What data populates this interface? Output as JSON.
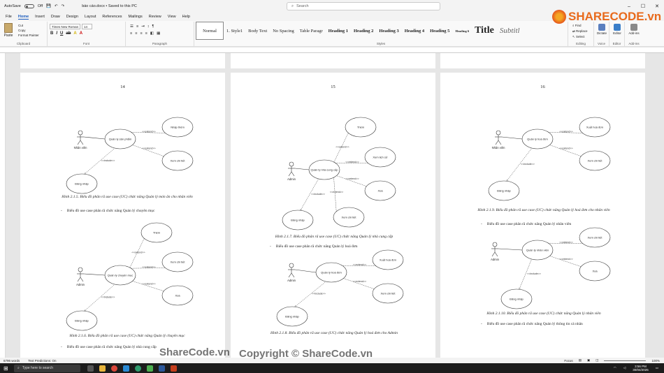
{
  "titlebar": {
    "autosave": "AutoSave",
    "autosave_state": "Off",
    "doc_title": "báo cáo.docx • Saved to this PC",
    "search_placeholder": "Search"
  },
  "menu": [
    "File",
    "Home",
    "Insert",
    "Draw",
    "Design",
    "Layout",
    "References",
    "Mailings",
    "Review",
    "View",
    "Help"
  ],
  "ribbon": {
    "clipboard": {
      "paste": "Paste",
      "cut": "Cut",
      "copy": "Copy",
      "format_painter": "Format Painter",
      "label": "Clipboard"
    },
    "font": {
      "name": "Times New Roman",
      "size": "14",
      "label": "Font"
    },
    "paragraph_label": "Paragraph",
    "styles": [
      "Normal",
      "1. Style1",
      "Body Text",
      "No Spacing",
      "Table Paragr",
      "Heading 1",
      "Heading 2",
      "Heading 3",
      "Heading 4",
      "Heading 5",
      "Heading 6",
      "Title",
      "Subtitl"
    ],
    "styles_label": "Styles",
    "editing": {
      "find": "Find",
      "replace": "Replace",
      "select": "Select",
      "label": "Editing"
    },
    "voice": {
      "dictate": "Dictate",
      "label": "Voice"
    },
    "editor": {
      "name": "Editor",
      "label": "Editor"
    },
    "addins": {
      "name": "Add-ins",
      "label": "Add-ins"
    }
  },
  "pages": [
    {
      "number": "14",
      "d1": {
        "actor": "Nhân viên",
        "center": "Quản lý sản phẩm",
        "ext": [
          "Nhập thêm",
          "Xem chi tiết"
        ],
        "login": "Đăng nhập",
        "extend": "<<extend>>",
        "include": "<<include>>"
      },
      "cap1": "Hình 2.1.5. Biểu đồ phân rã use case (UC) chức năng Quản lý món ăn cho nhân viên",
      "bullet1": "Biểu đồ use case phân rã chức năng Quản lý chuyên mục",
      "d2": {
        "actor": "Admin",
        "center": "Quản lý chuyên mục",
        "ext": [
          "Thêm",
          "Xem chi tiết",
          "Xoá"
        ],
        "login": "Đăng nhập",
        "extend": "<<extend>>",
        "include": "<<include>>"
      },
      "cap2": "Hình 2.1.6. Biểu đồ phân rã use case (UC) chức năng Quản lý chuyên mục",
      "bullet2": "Biểu đồ use case phân rã chức năng Quản lý nhà cung cấp"
    },
    {
      "number": "15",
      "d1": {
        "actor": "Admin",
        "center": "Quản lý nhà cung cấp",
        "ext": [
          "Thêm",
          "Xem lịch sử",
          "Xoá",
          "Xem chi tiết"
        ],
        "login": "Đăng nhập",
        "extend": "<<extend>>",
        "include": "<<include>>"
      },
      "cap1": "Hình 2.1.7. Biểu đồ phân rã use case (UC) chức năng Quản lý nhà cung cấp",
      "bullet1": "Biểu đồ use case phân rã chức năng Quản lý hoá đơn",
      "d2": {
        "actor": "Admin",
        "center": "Quản lý hoá đơn",
        "ext": [
          "Xuất hoá đơn",
          "Xem chi tiết"
        ],
        "login": "Đăng nhập",
        "extend": "<<extend>>",
        "include": "<<include>>"
      },
      "cap2": "Hình 2.1.8. Biểu đồ phân rã use case (UC) chức năng Quản lý hoá đơn cho Admin"
    },
    {
      "number": "16",
      "d1": {
        "actor": "Nhân viên",
        "center": "Quản lý hoá đơn",
        "ext": [
          "Xuất hoá đơn",
          "Xem chi tiết"
        ],
        "login": "Đăng nhập",
        "extend": "<<extend>>",
        "include": "<<include>>"
      },
      "cap1": "Hình 2.1.9. Biểu đồ phân rã use case (UC) chức năng Quản lý hoá đơn cho nhân viên",
      "bullet1": "Biểu đồ use case phân rã chức năng Quản lý nhân viên",
      "d2": {
        "actor": "Admin",
        "center": "Quản lý nhân viên",
        "ext": [
          "Xem chi tiết",
          "Xoá"
        ],
        "login": "Đăng nhập",
        "extend": "<<extend>>",
        "include": "<<include>>"
      },
      "cap2": "Hình 2.1.10. Biểu đồ phân rã use case (UC) chức năng Quản lý nhân viên",
      "bullet2": "Biểu đồ use case phân rã chức năng Quản lý thông tin cá nhân"
    }
  ],
  "status": {
    "words": "6796 words",
    "predictions": "Text Predictions: On",
    "focus": "Focus",
    "zoom": "100%"
  },
  "taskbar": {
    "search": "Type here to search",
    "time": "3:56 PM",
    "date": "30/04/2025"
  },
  "watermark": {
    "logo": "SHARECODE.vn",
    "text": "Copyright © ShareCode.vn",
    "left": "ShareCode.vn"
  },
  "colors": {
    "accent": "#185abd",
    "taskbar": "#1c1c1c"
  }
}
